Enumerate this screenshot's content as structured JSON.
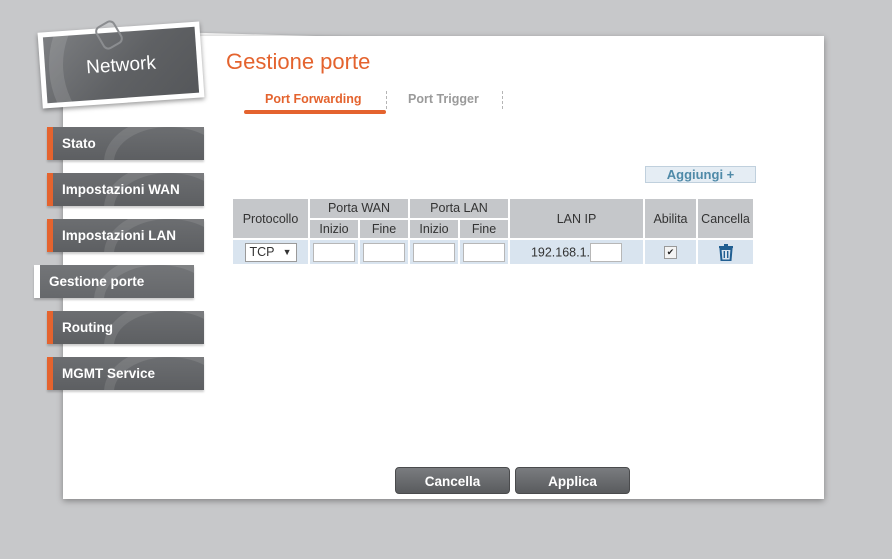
{
  "app": {
    "section_title": "Network"
  },
  "sidebar": {
    "items": [
      {
        "label": "Stato",
        "active": false
      },
      {
        "label": "Impostazioni WAN",
        "active": false
      },
      {
        "label": "Impostazioni LAN",
        "active": false
      },
      {
        "label": "Gestione porte",
        "active": true
      },
      {
        "label": "Routing",
        "active": false
      },
      {
        "label": "MGMT Service",
        "active": false
      }
    ]
  },
  "main": {
    "title": "Gestione porte",
    "tabs": [
      {
        "label": "Port Forwarding",
        "active": true
      },
      {
        "label": "Port Trigger",
        "active": false
      }
    ],
    "add_button": "Aggiungi +",
    "table": {
      "headers": {
        "protocol": "Protocollo",
        "wan_port": "Porta WAN",
        "lan_port": "Porta LAN",
        "start": "Inizio",
        "end": "Fine",
        "lan_ip": "LAN IP",
        "enable": "Abilita",
        "delete": "Cancella"
      },
      "rows": [
        {
          "protocol": "TCP",
          "wan_start": "",
          "wan_end": "",
          "lan_start": "",
          "lan_end": "",
          "ip_prefix": "192.168.1.",
          "ip_last": "",
          "enabled": true
        }
      ]
    },
    "buttons": {
      "cancel": "Cancella",
      "apply": "Applica"
    }
  },
  "colors": {
    "accent": "#e4632e",
    "link_blue": "#4f8aa8",
    "icon_blue": "#215f92"
  },
  "icons": {
    "delete": "trash-icon",
    "dropdown": "chevron-down-icon",
    "check": "checkmark-icon"
  }
}
